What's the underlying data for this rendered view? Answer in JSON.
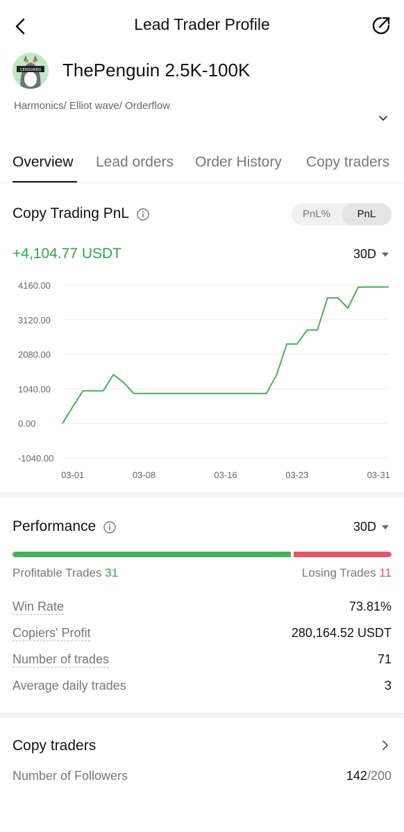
{
  "header": {
    "title": "Lead Trader Profile",
    "back_icon": "chevron-left-icon",
    "share_icon": "share-icon"
  },
  "profile": {
    "name": "ThePenguin 2.5K-100K",
    "bio": "Harmonics/ Elliot wave/ Orderflow",
    "avatar_text": "CENSORED",
    "avatar_color": "#bfe8c4"
  },
  "tabs": [
    {
      "label": "Overview",
      "active": true
    },
    {
      "label": "Lead orders",
      "active": false
    },
    {
      "label": "Order History",
      "active": false
    },
    {
      "label": "Copy traders",
      "active": false
    }
  ],
  "pnl": {
    "title": "Copy Trading PnL",
    "toggle": [
      "PnL%",
      "PnL"
    ],
    "toggle_active": "PnL",
    "value": "+4,104.77 USDT",
    "period": "30D"
  },
  "chart_data": {
    "type": "line",
    "title": "",
    "xlabel": "",
    "ylabel": "",
    "y_ticks": [
      "4160.00",
      "3120.00",
      "2080.00",
      "1040.00",
      "0.00",
      "-1040.00"
    ],
    "x_ticks": [
      "03-01",
      "03-08",
      "03-16",
      "03-23",
      "03-31"
    ],
    "ylim": [
      -1040,
      4160
    ],
    "grid": true,
    "color": "#4cae5b",
    "series": [
      {
        "x": [
          "02-28",
          "03-01",
          "03-02",
          "03-04",
          "03-05",
          "03-06",
          "03-07",
          "03-08",
          "03-12",
          "03-16",
          "03-20",
          "03-21",
          "03-22",
          "03-23",
          "03-24",
          "03-25",
          "03-26",
          "03-27",
          "03-28",
          "03-29",
          "03-30",
          "03-31",
          "04-01"
        ],
        "values": [
          0,
          500,
          980,
          980,
          1470,
          1230,
          900,
          900,
          900,
          900,
          900,
          1460,
          2390,
          2390,
          2810,
          2810,
          3780,
          3780,
          3470,
          4100,
          4105,
          4105,
          4105
        ]
      }
    ]
  },
  "performance": {
    "title": "Performance",
    "period": "30D",
    "profitable_label": "Profitable Trades",
    "profitable_count": "31",
    "losing_label": "Losing Trades",
    "losing_count": "11",
    "win_ratio": 0.738,
    "metrics": [
      {
        "label": "Win Rate",
        "value": "73.81%",
        "dashed": true
      },
      {
        "label": "Copiers' Profit",
        "value": "280,164.52 USDT",
        "dashed": true
      },
      {
        "label": "Number of trades",
        "value": "71",
        "dashed": true
      },
      {
        "label": "Average daily trades",
        "value": "3",
        "dashed": false
      }
    ]
  },
  "copy_traders": {
    "title": "Copy traders",
    "followers_label": "Number of Followers",
    "followers_count": "142",
    "followers_max": "/200"
  }
}
